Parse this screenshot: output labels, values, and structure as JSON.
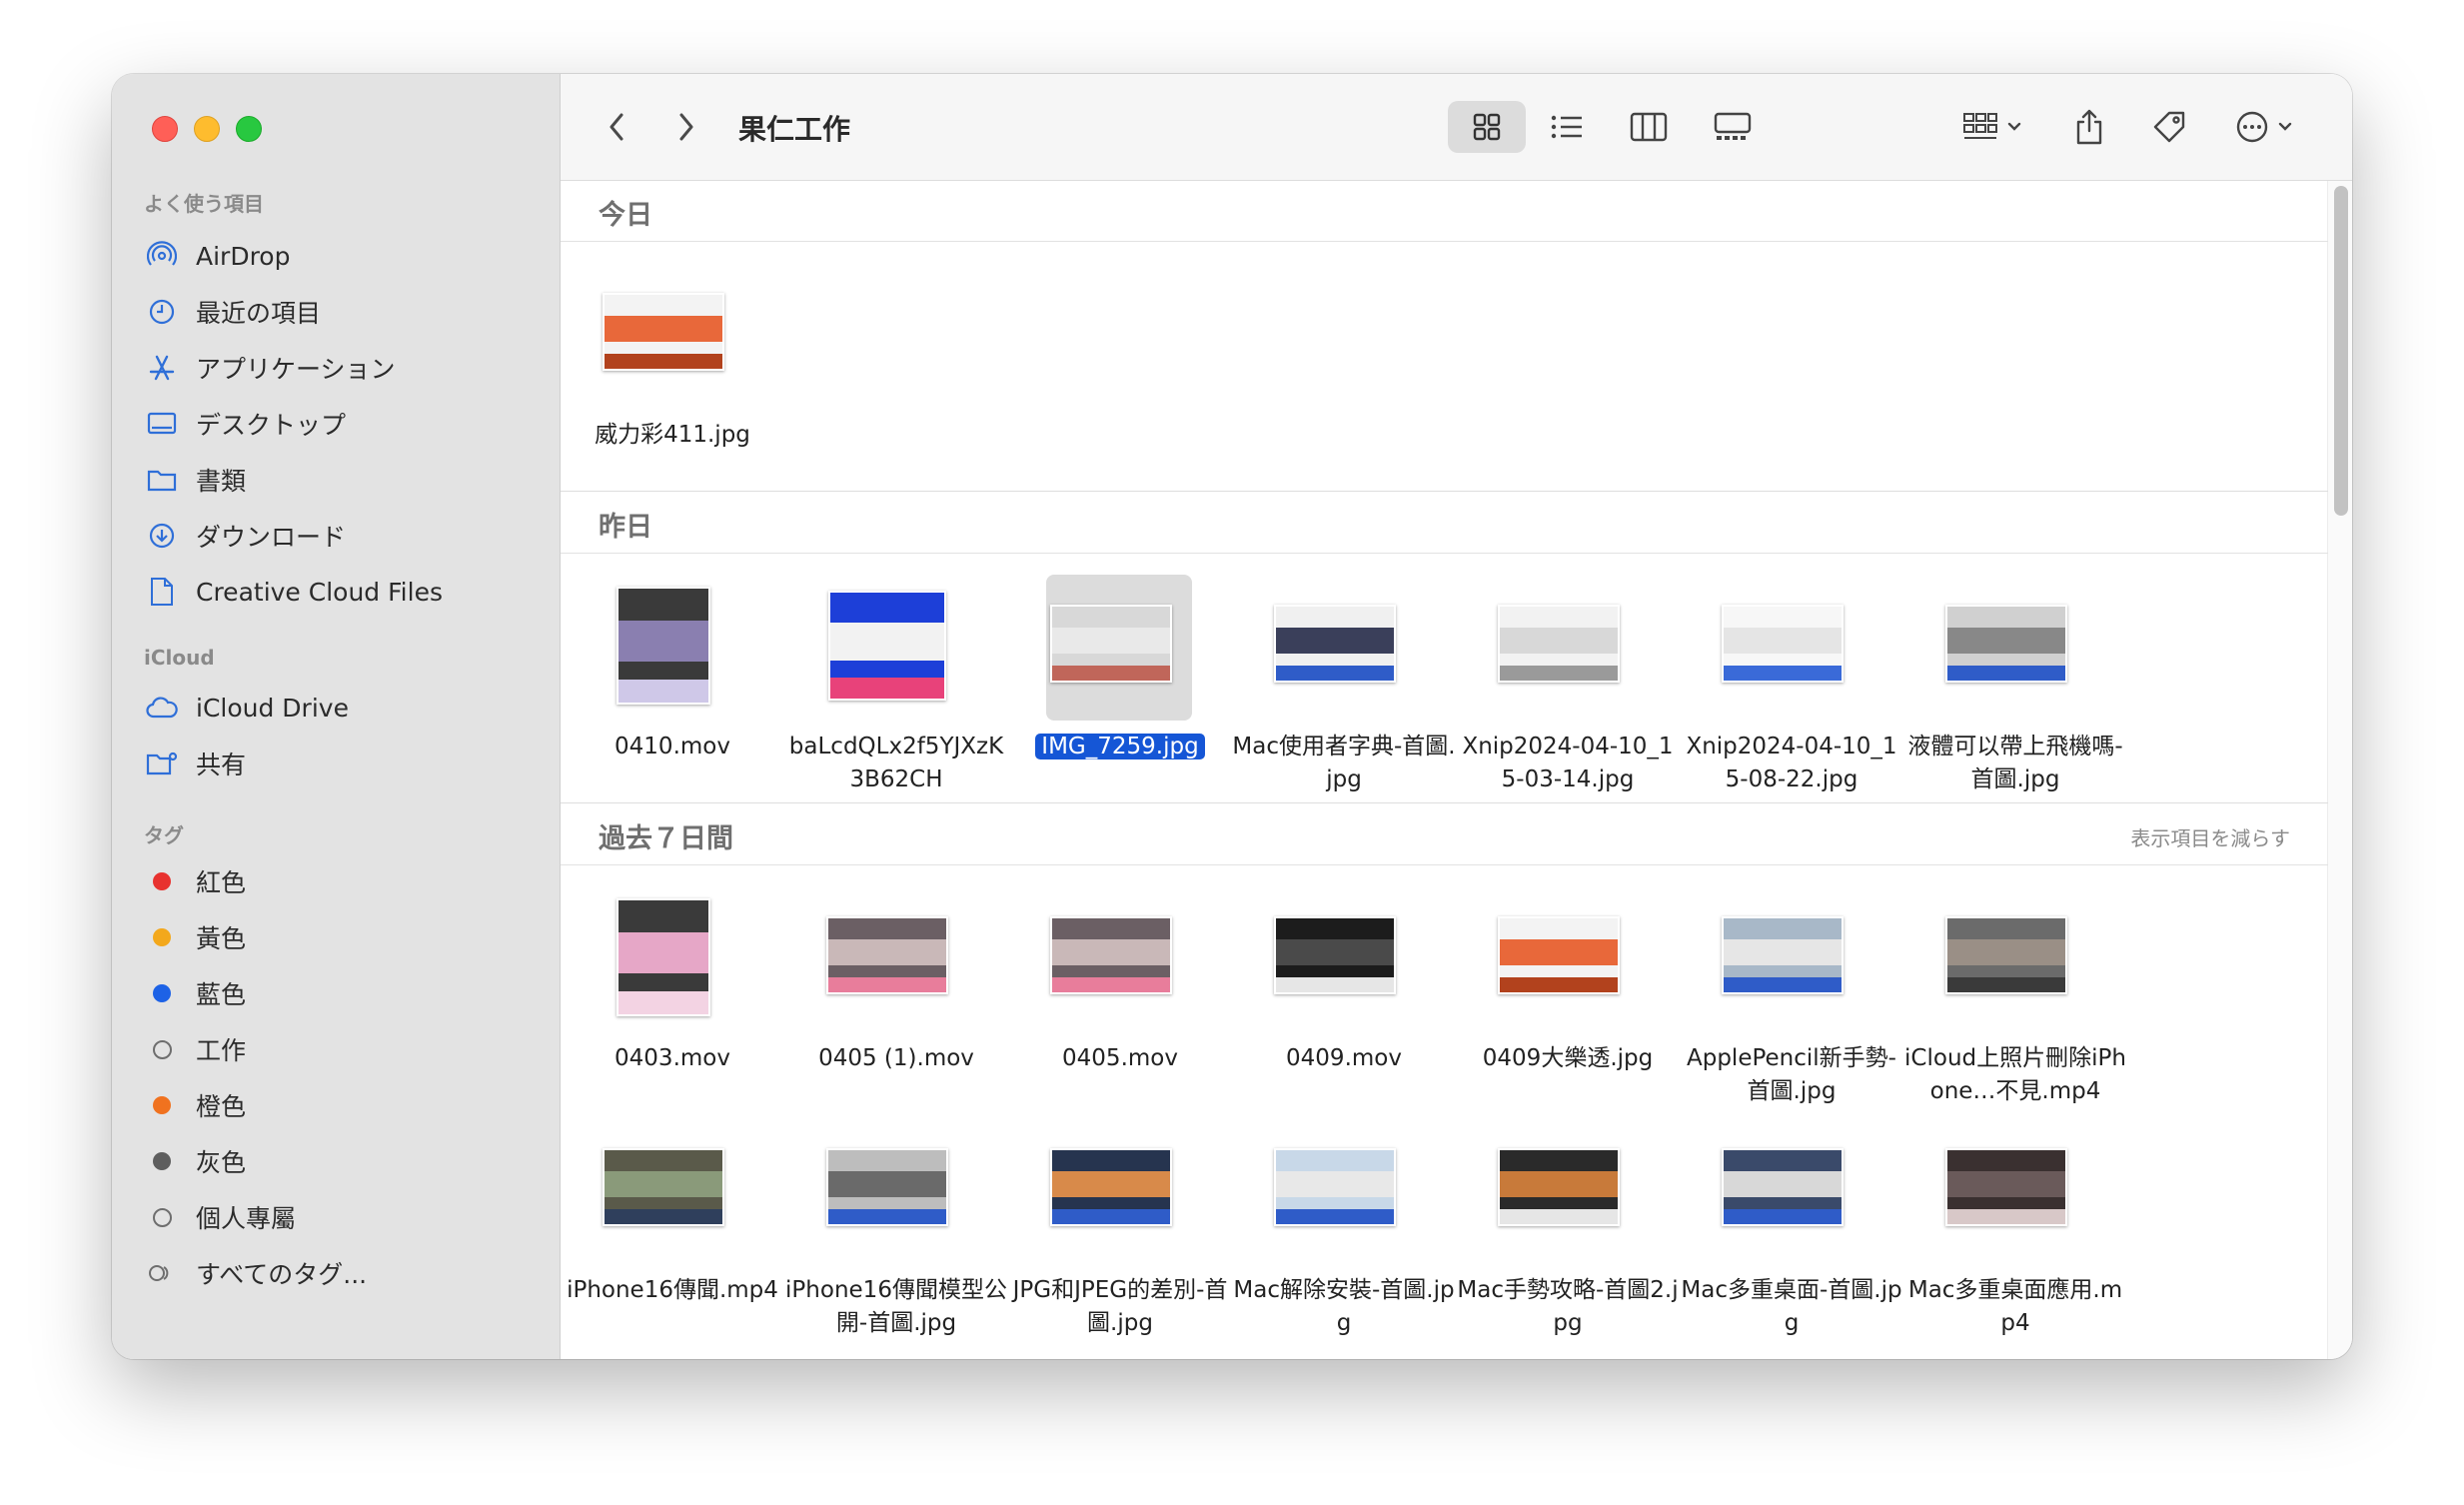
{
  "window": {
    "title": "果仁工作"
  },
  "sidebar": {
    "favorites_heading": "よく使う項目",
    "favorites": [
      {
        "label": "AirDrop",
        "icon": "airdrop-icon"
      },
      {
        "label": "最近の項目",
        "icon": "clock-icon"
      },
      {
        "label": "アプリケーション",
        "icon": "applications-icon"
      },
      {
        "label": "デスクトップ",
        "icon": "desktop-icon"
      },
      {
        "label": "書類",
        "icon": "folder-icon"
      },
      {
        "label": "ダウンロード",
        "icon": "download-icon"
      },
      {
        "label": "Creative Cloud Files",
        "icon": "document-icon"
      }
    ],
    "icloud_heading": "iCloud",
    "icloud": [
      {
        "label": "iCloud Drive",
        "icon": "cloud-icon"
      },
      {
        "label": "共有",
        "icon": "shared-folder-icon"
      }
    ],
    "tags_heading": "タグ",
    "tags": [
      {
        "label": "紅色",
        "color": "#e8322f"
      },
      {
        "label": "黃色",
        "color": "#f3a81c"
      },
      {
        "label": "藍色",
        "color": "#1d62e6"
      },
      {
        "label": "工作",
        "color": ""
      },
      {
        "label": "橙色",
        "color": "#f0721f"
      },
      {
        "label": "灰色",
        "color": "#5e5e5e"
      },
      {
        "label": "個人專屬",
        "color": ""
      },
      {
        "label": "すべてのタグ...",
        "color": "all"
      }
    ]
  },
  "groups": [
    {
      "title": "今日",
      "action": "",
      "files": [
        {
          "name": "威力彩411.jpg",
          "kind": "banner"
        }
      ]
    },
    {
      "title": "昨日",
      "action": "",
      "files": [
        {
          "name": "0410.mov",
          "kind": "phone"
        },
        {
          "name": "baLcdQLx2f5YJXzK3B62CH",
          "kind": "bottles"
        },
        {
          "name": "IMG_7259.jpg",
          "kind": "photo",
          "selected": true
        },
        {
          "name": "Mac使用者字典-首圖.jpg",
          "kind": "doc"
        },
        {
          "name": "Xnip2024-04-10_15-03-14.jpg",
          "kind": "screen"
        },
        {
          "name": "Xnip2024-04-10_15-08-22.jpg",
          "kind": "screen2"
        },
        {
          "name": "液體可以帶上飛機嗎-首圖.jpg",
          "kind": "bottles2"
        }
      ]
    },
    {
      "title": "過去７日間",
      "action": "表示項目を減らす",
      "files": [
        {
          "name": "0403.mov",
          "kind": "phone2"
        },
        {
          "name": "0405 (1).mov",
          "kind": "video"
        },
        {
          "name": "0405.mov",
          "kind": "video"
        },
        {
          "name": "0409.mov",
          "kind": "dark"
        },
        {
          "name": "0409大樂透.jpg",
          "kind": "banner"
        },
        {
          "name": "ApplePencil新手勢-首圖.jpg",
          "kind": "tablet"
        },
        {
          "name": "iCloud上照片刪除iPhone…不見.mp4",
          "kind": "hands"
        },
        {
          "name": "iPhone16傳聞.mp4",
          "kind": "street"
        },
        {
          "name": "iPhone16傳聞模型公開-首圖.jpg",
          "kind": "models"
        },
        {
          "name": "JPG和JPEG的差別-首圖.jpg",
          "kind": "sunset"
        },
        {
          "name": "Mac解除安裝-首圖.jpg",
          "kind": "desk"
        },
        {
          "name": "Mac手勢攻略-首圖2.jpg",
          "kind": "keyboard"
        },
        {
          "name": "Mac多重桌面-首圖.jpg",
          "kind": "monitor"
        },
        {
          "name": "Mac多重桌面應用.mp4",
          "kind": "laptop"
        }
      ]
    }
  ],
  "colors": {
    "selection": "#1556d6",
    "sidebar": "#e3e3e3"
  }
}
